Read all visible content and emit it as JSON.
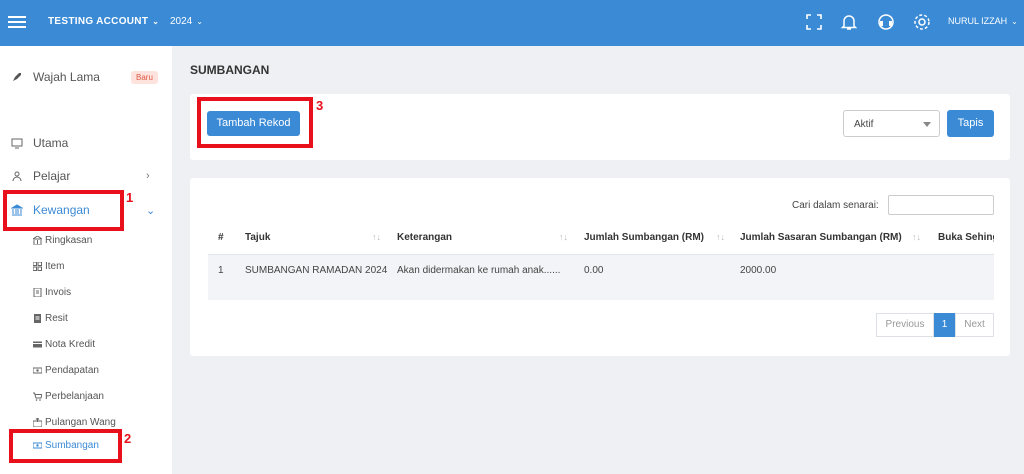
{
  "topbar": {
    "account": "TESTING ACCOUNT",
    "year": "2024",
    "user": "NURUL IZZAH",
    "icons": [
      "fullscreen-icon",
      "bell-icon",
      "headset-icon",
      "settings-icon"
    ]
  },
  "sidebar": {
    "wajah_lama": "Wajah Lama",
    "badge": "Baru",
    "items": [
      {
        "label": "Utama"
      },
      {
        "label": "Pelajar"
      },
      {
        "label": "Kewangan"
      }
    ],
    "subitems": [
      {
        "label": "Ringkasan"
      },
      {
        "label": "Item"
      },
      {
        "label": "Invois"
      },
      {
        "label": "Resit"
      },
      {
        "label": "Nota Kredit"
      },
      {
        "label": "Pendapatan"
      },
      {
        "label": "Perbelanjaan"
      },
      {
        "label": "Pulangan Wang"
      },
      {
        "label": "Sumbangan"
      }
    ]
  },
  "annotations": [
    "1",
    "2",
    "3"
  ],
  "main": {
    "title": "SUMBANGAN",
    "add_button": "Tambah Rekod",
    "status_select": "Aktif",
    "filter_button": "Tapis",
    "search_label": "Cari dalam senarai:",
    "search_value": "",
    "table": {
      "headers": [
        "#",
        "Tajuk",
        "Keterangan",
        "Jumlah Sumbangan (RM)",
        "Jumlah Sasaran Sumbangan (RM)",
        "Buka Sehing"
      ],
      "rows": [
        [
          "1",
          "SUMBANGAN RAMADAN 2024",
          "Akan didermakan ke rumah anak......",
          "0.00",
          "2000.00",
          ""
        ]
      ]
    },
    "pagination": {
      "previous": "Previous",
      "current": "1",
      "next": "Next"
    }
  },
  "colors": {
    "primary": "#3a8ad6",
    "highlight": "#e8101b",
    "badge_bg": "#fde2dd"
  }
}
